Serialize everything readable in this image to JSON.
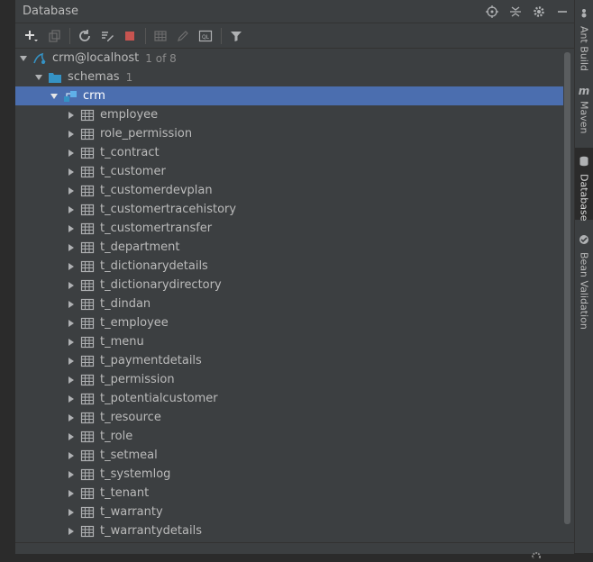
{
  "panel": {
    "title": "Database"
  },
  "tree": {
    "datasource": {
      "label": "crm@localhost",
      "count": "1 of 8"
    },
    "schemas": {
      "label": "schemas",
      "count": "1"
    },
    "schema": {
      "label": "crm"
    },
    "tables": [
      "employee",
      "role_permission",
      "t_contract",
      "t_customer",
      "t_customerdevplan",
      "t_customertracehistory",
      "t_customertransfer",
      "t_department",
      "t_dictionarydetails",
      "t_dictionarydirectory",
      "t_dindan",
      "t_employee",
      "t_menu",
      "t_paymentdetails",
      "t_permission",
      "t_potentialcustomer",
      "t_resource",
      "t_role",
      "t_setmeal",
      "t_systemlog",
      "t_tenant",
      "t_warranty",
      "t_warrantydetails"
    ]
  },
  "sidebar_tabs": [
    "Ant Build",
    "Maven",
    "Database",
    "Bean Validation"
  ],
  "colors": {
    "selection": "#4b6eaf",
    "panel_bg": "#3c3f41",
    "text": "#bbbbbb",
    "stop_red": "#c75450",
    "folder_blue": "#3592c4"
  }
}
